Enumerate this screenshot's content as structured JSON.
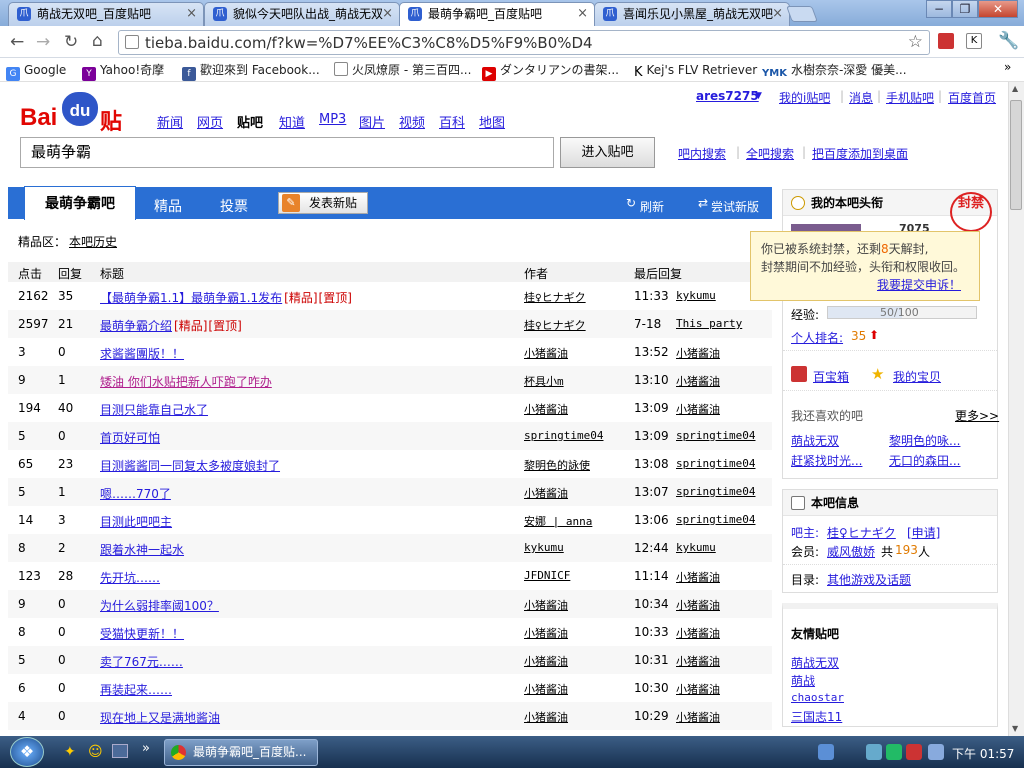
{
  "browser": {
    "tabs": [
      {
        "label": "萌战无双吧_百度贴吧"
      },
      {
        "label": "貌似今天吧队出战_萌战无双"
      },
      {
        "label": "最萌争霸吧_百度贴吧"
      },
      {
        "label": "喜闻乐见小黑屋_萌战无双吧"
      }
    ],
    "url": "tieba.baidu.com/f?kw=%D7%EE%C3%C8%D5%F9%B0%D4",
    "bookmarks": [
      {
        "label": "Google",
        "icon": "google-icon"
      },
      {
        "label": "Yahoo!奇摩",
        "icon": "yahoo-icon"
      },
      {
        "label": "歡迎來到 Facebook...",
        "icon": "facebook-icon"
      },
      {
        "label": "火凤燎原 - 第三百四...",
        "icon": "page-icon"
      },
      {
        "label": "ダンタリアンの書架...",
        "icon": "youtube-icon"
      },
      {
        "label": "Kej's FLV Retriever",
        "icon": "k-icon"
      },
      {
        "label": "水樹奈奈-深愛 優美...",
        "icon": "ymk-icon"
      }
    ],
    "ymk_text": "YMK",
    "k_text": "K"
  },
  "header": {
    "logo_bai": "Bai",
    "logo_du": "du",
    "logo_tieba": "贴吧",
    "username": "ares7275",
    "user_links": [
      "我的i贴吧",
      "消息",
      "手机贴吧",
      "百度首页"
    ],
    "nav": [
      "新闻",
      "网页",
      "贴吧",
      "知道",
      "MP3",
      "图片",
      "视频",
      "百科",
      "地图"
    ],
    "search_value": "最萌争霸",
    "search_button": "进入贴吧",
    "search_links": [
      "吧内搜索",
      "全吧搜索",
      "把百度添加到桌面"
    ]
  },
  "forum": {
    "tabs": [
      "最萌争霸吧",
      "精品",
      "投票"
    ],
    "post_button": "发表新贴",
    "refresh": "刷新",
    "try_new": "尝试新版",
    "subnav_label": "精品区：",
    "subnav_link": "本吧历史",
    "columns": {
      "clicks": "点击",
      "replies": "回复",
      "title": "标题",
      "author": "作者",
      "last": "最后回复"
    },
    "rows": [
      {
        "clicks": "2162",
        "replies": "35",
        "title": "【最萌争霸1.1】最萌争霸1.1发布",
        "tags": [
          "[精品]",
          "[置顶]"
        ],
        "author": "桂♀ヒナギク",
        "time": "11:33",
        "last": "kykumu"
      },
      {
        "clicks": "2597",
        "replies": "21",
        "title": "最萌争霸介绍",
        "tags": [
          "[精品]",
          "[置顶]"
        ],
        "author": "桂♀ヒナギク",
        "time": "7-18",
        "last": "This party"
      },
      {
        "clicks": "3",
        "replies": "0",
        "title": "求酱酱團版！！",
        "tags": [],
        "author": "小猪酱油",
        "time": "13:52",
        "last": "小猪酱油"
      },
      {
        "clicks": "9",
        "replies": "1",
        "title": "矮油 你们水贴把新人吓跑了咋办",
        "tags": [],
        "author": "杯具小m",
        "time": "13:10",
        "last": "小猪酱油"
      },
      {
        "clicks": "194",
        "replies": "40",
        "title": "目测只能靠自己水了",
        "tags": [],
        "author": "小猪酱油",
        "time": "13:09",
        "last": "小猪酱油"
      },
      {
        "clicks": "5",
        "replies": "0",
        "title": "首页好可怕",
        "tags": [],
        "author": "springtime04",
        "time": "13:09",
        "last": "springtime04"
      },
      {
        "clicks": "65",
        "replies": "23",
        "title": "目测酱酱同一同复太多被度娘封了",
        "tags": [],
        "author": "黎明色的詠使",
        "time": "13:08",
        "last": "springtime04"
      },
      {
        "clicks": "5",
        "replies": "1",
        "title": "嗯……770了",
        "tags": [],
        "author": "小猪酱油",
        "time": "13:07",
        "last": "springtime04"
      },
      {
        "clicks": "14",
        "replies": "3",
        "title": "目测此吧吧主",
        "tags": [],
        "author": "安娜 | anna",
        "time": "13:06",
        "last": "springtime04"
      },
      {
        "clicks": "8",
        "replies": "2",
        "title": "跟着水神一起水",
        "tags": [],
        "author": "kykumu",
        "time": "12:44",
        "last": "kykumu"
      },
      {
        "clicks": "123",
        "replies": "28",
        "title": "先开坑……",
        "tags": [],
        "author": "JFDNICF",
        "time": "11:14",
        "last": "小猪酱油"
      },
      {
        "clicks": "9",
        "replies": "0",
        "title": "为什么弱排率阈100？",
        "tags": [],
        "author": "小猪酱油",
        "time": "10:34",
        "last": "小猪酱油"
      },
      {
        "clicks": "8",
        "replies": "0",
        "title": "受猫快更新！！",
        "tags": [],
        "author": "小猪酱油",
        "time": "10:33",
        "last": "小猪酱油"
      },
      {
        "clicks": "5",
        "replies": "0",
        "title": "卖了767元……",
        "tags": [],
        "author": "小猪酱油",
        "time": "10:31",
        "last": "小猪酱油"
      },
      {
        "clicks": "6",
        "replies": "0",
        "title": "再装起来……",
        "tags": [],
        "author": "小猪酱油",
        "time": "10:30",
        "last": "小猪酱油"
      },
      {
        "clicks": "4",
        "replies": "0",
        "title": "现在地上又是满地酱油",
        "tags": [],
        "author": "小猪酱油",
        "time": "10:29",
        "last": "小猪酱油"
      }
    ]
  },
  "sidebar": {
    "title_box": {
      "heading": "我的本吧头衔",
      "seal_text": "封禁",
      "level_partial": "7075",
      "notice_line1_a": "你已被系统封禁，还剩",
      "notice_days": "8",
      "notice_line1_b": "天解封,",
      "notice_line2": "封禁期间不加经验，头衔和权限收回。",
      "appeal_link": "我要提交申诉！",
      "exp_label": "经验:",
      "exp_value": "50/100",
      "exp_progress": 0.5,
      "rank_label": "个人排名:",
      "rank_value": "35",
      "treasure": "百宝箱",
      "my_treasure": "我的宝贝",
      "also_like": "我还喜欢的吧",
      "more": "更多>>",
      "liked": [
        "萌战无双",
        "黎明色的咏...",
        "赶紧找时光...",
        "无口的森田..."
      ]
    },
    "info_box": {
      "heading": "本吧信息",
      "owner_label": "吧主:",
      "owner": "桂♀ヒナギク",
      "apply": "[申请]",
      "member_label": "会员:",
      "member_name": "威风傲娇",
      "member_total_a": "共",
      "member_count": "193",
      "member_total_b": "人",
      "dir_label": "目录:",
      "dir_link": "其他游戏及话题"
    },
    "friend_box": {
      "heading": "友情贴吧",
      "links": [
        "萌战无双",
        "萌战",
        "chaostar",
        "三国志11"
      ]
    }
  },
  "taskbar": {
    "window_title": "最萌争霸吧_百度贴...",
    "clock": "下午 01:57"
  },
  "colors": {
    "accent": "#2a6fd4",
    "link": "#261cdc",
    "red": "#cc0000"
  }
}
